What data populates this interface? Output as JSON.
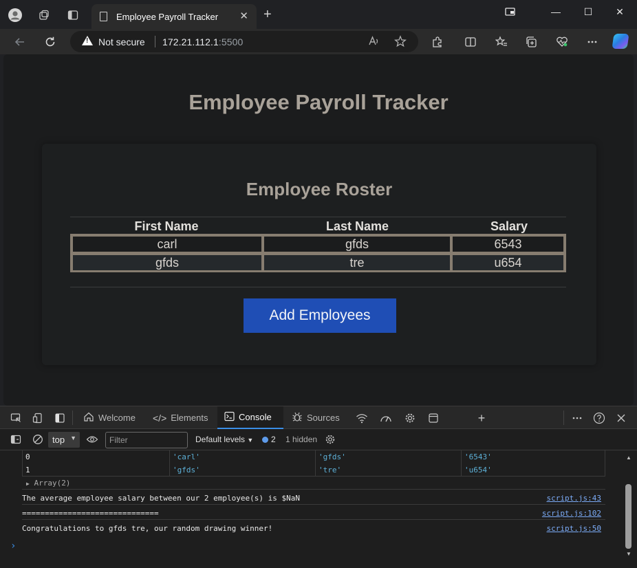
{
  "browser": {
    "tab_title": "Employee Payroll Tracker",
    "tab_close": "✕",
    "new_tab": "+",
    "security_label": "Not secure",
    "url_host": "172.21.112.1",
    "url_port": ":5500",
    "window": {
      "minimize": "—",
      "maximize": "☐",
      "close": "✕"
    }
  },
  "page": {
    "title": "Employee Payroll Tracker",
    "roster_title": "Employee Roster",
    "columns": [
      "First Name",
      "Last Name",
      "Salary"
    ],
    "rows": [
      {
        "first": "carl",
        "last": "gfds",
        "salary": "6543"
      },
      {
        "first": "gfds",
        "last": "tre",
        "salary": "u654"
      }
    ],
    "add_button": "Add Employees"
  },
  "devtools": {
    "tabs": {
      "welcome": "Welcome",
      "elements": "Elements",
      "console": "Console",
      "sources": "Sources"
    },
    "toolbar": {
      "context": "top",
      "filter_placeholder": "Filter",
      "levels": "Default levels",
      "message_count": "2",
      "hidden": "1 hidden"
    },
    "console": {
      "table_rows": [
        {
          "index": "0",
          "c1": "'carl'",
          "c2": "'gfds'",
          "c3": "'6543'"
        },
        {
          "index": "1",
          "c1": "'gfds'",
          "c2": "'tre'",
          "c3": "'u654'"
        }
      ],
      "array_summary": "Array(2)",
      "logs": [
        {
          "text": "The average employee salary between our 2 employee(s) is $NaN",
          "source": "script.js:43"
        },
        {
          "text": "==============================",
          "source": "script.js:102"
        },
        {
          "text": "Congratulations to gfds tre, our random drawing winner!",
          "source": "script.js:50"
        }
      ],
      "prompt": "›"
    }
  },
  "colors": {
    "accent_button": "#1f4eb5",
    "heading": "#a9a299",
    "table_border": "#877d70",
    "link": "#7cacf8"
  }
}
